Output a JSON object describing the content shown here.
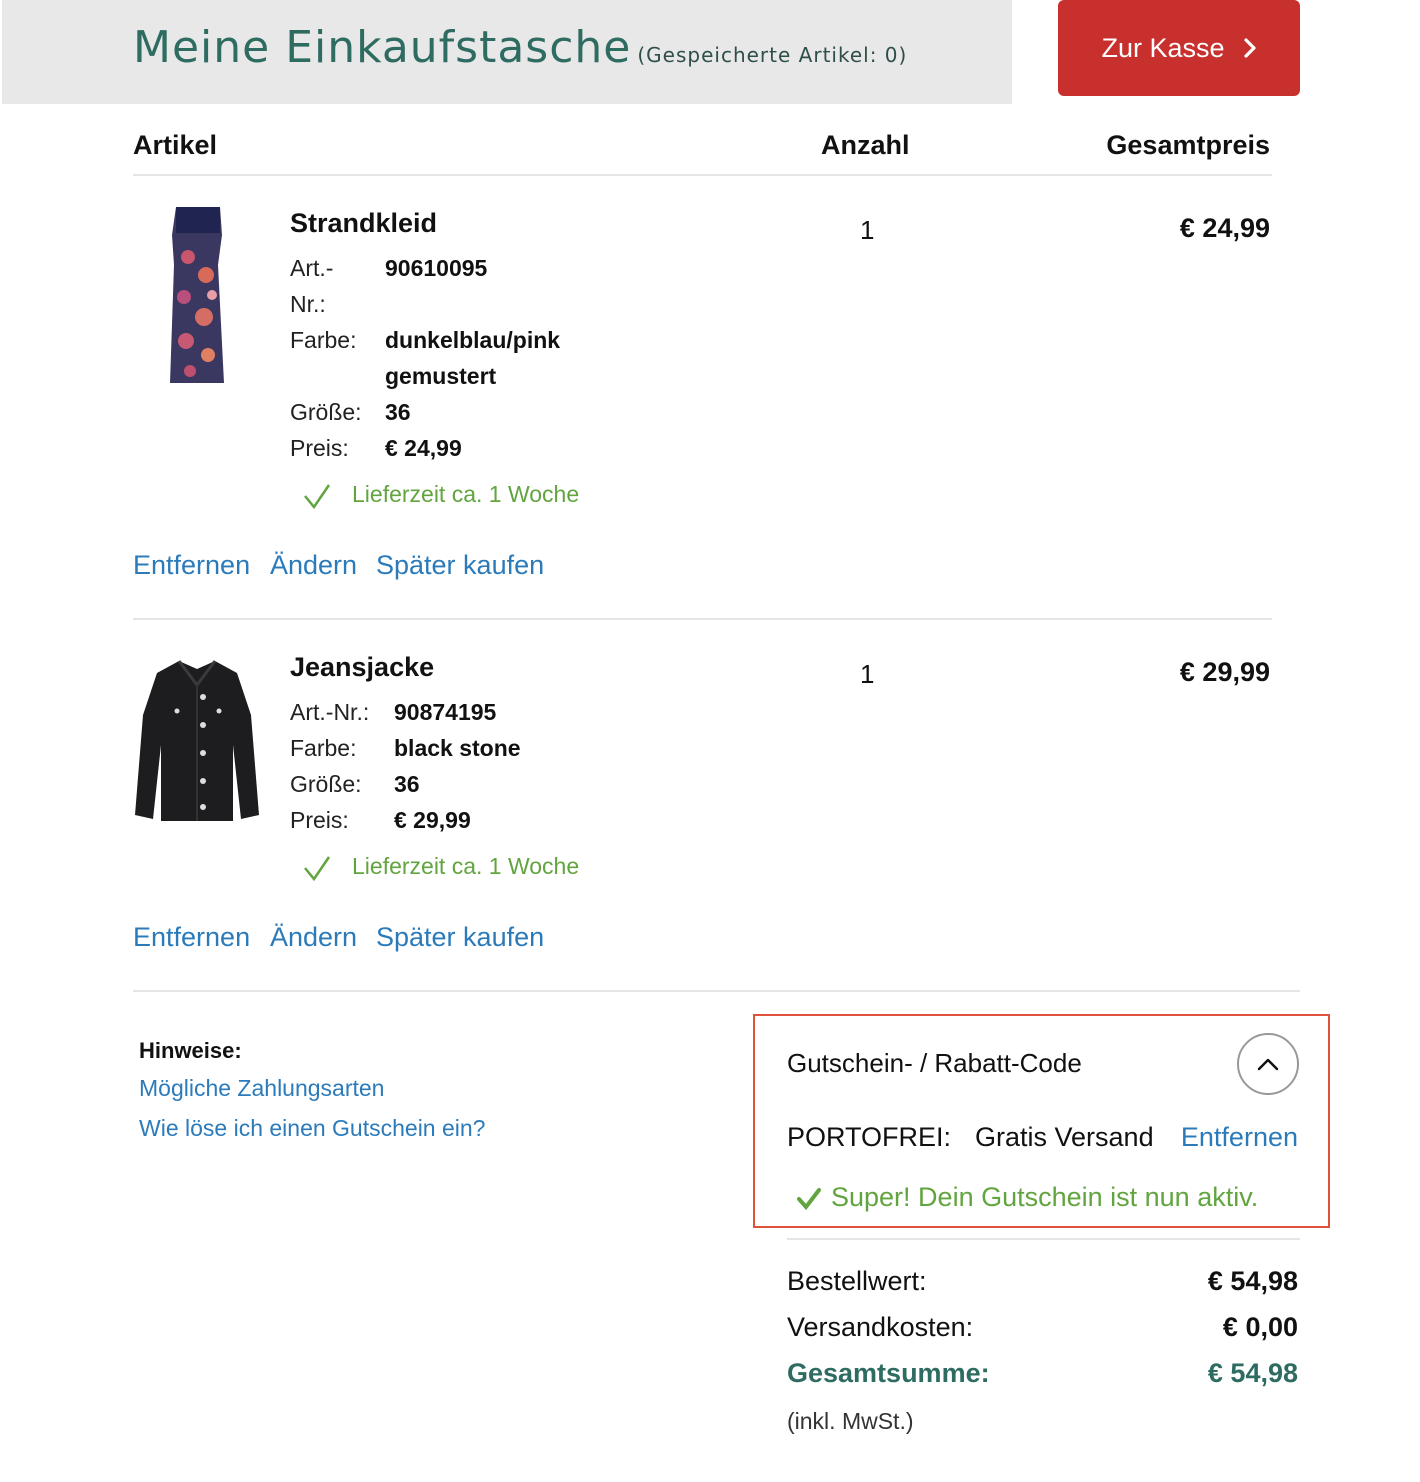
{
  "header": {
    "title": "Meine Einkaufstasche",
    "saved_items": "(Gespeicherte Artikel: 0)",
    "checkout_label": "Zur Kasse",
    "checkout_icon": "chevron-right-icon",
    "colors": {
      "header_bg": "#e8e8e8",
      "title": "#2e6b61",
      "checkout_bg": "#c8302e"
    }
  },
  "table": {
    "col_article": "Artikel",
    "col_quantity": "Anzahl",
    "col_total": "Gesamtpreis"
  },
  "items": [
    {
      "name": "Strandkleid",
      "art_label_1": "Art.-",
      "art_label_2": "Nr.:",
      "art_no": "90610095",
      "color_label": "Farbe:",
      "color_1": "dunkelblau/pink",
      "color_2": "gemustert",
      "size_label": "Größe:",
      "size": "36",
      "price_label": "Preis:",
      "price": "€ 24,99",
      "delivery": "Lieferzeit ca. 1 Woche",
      "quantity": "1",
      "total": "€ 24,99",
      "actions": {
        "remove": "Entfernen",
        "change": "Ändern",
        "later": "Später kaufen"
      }
    },
    {
      "name": "Jeansjacke",
      "art_label": "Art.-Nr.:",
      "art_no": "90874195",
      "color_label": "Farbe:",
      "color": "black stone",
      "size_label": "Größe:",
      "size": "36",
      "price_label": "Preis:",
      "price": "€ 29,99",
      "delivery": "Lieferzeit ca. 1 Woche",
      "quantity": "1",
      "total": "€ 29,99",
      "actions": {
        "remove": "Entfernen",
        "change": "Ändern",
        "later": "Später kaufen"
      }
    }
  ],
  "hints": {
    "title": "Hinweise:",
    "links": [
      "Mögliche Zahlungsarten",
      "Wie löse ich einen Gutschein ein?"
    ]
  },
  "coupon": {
    "title": "Gutschein- / Rabatt-Code",
    "toggle_icon": "chevron-up-icon",
    "code": "PORTOFREI:",
    "code_desc": "Gratis Versand",
    "remove": "Entfernen",
    "success": "Super! Dein Gutschein ist nun aktiv."
  },
  "summary": {
    "order_value_label": "Bestellwert:",
    "order_value": "€ 54,98",
    "shipping_label": "Versandkosten:",
    "shipping": "€ 0,00",
    "total_label": "Gesamtsumme:",
    "total": "€ 54,98",
    "vat_note": "(inkl. MwSt.)"
  }
}
